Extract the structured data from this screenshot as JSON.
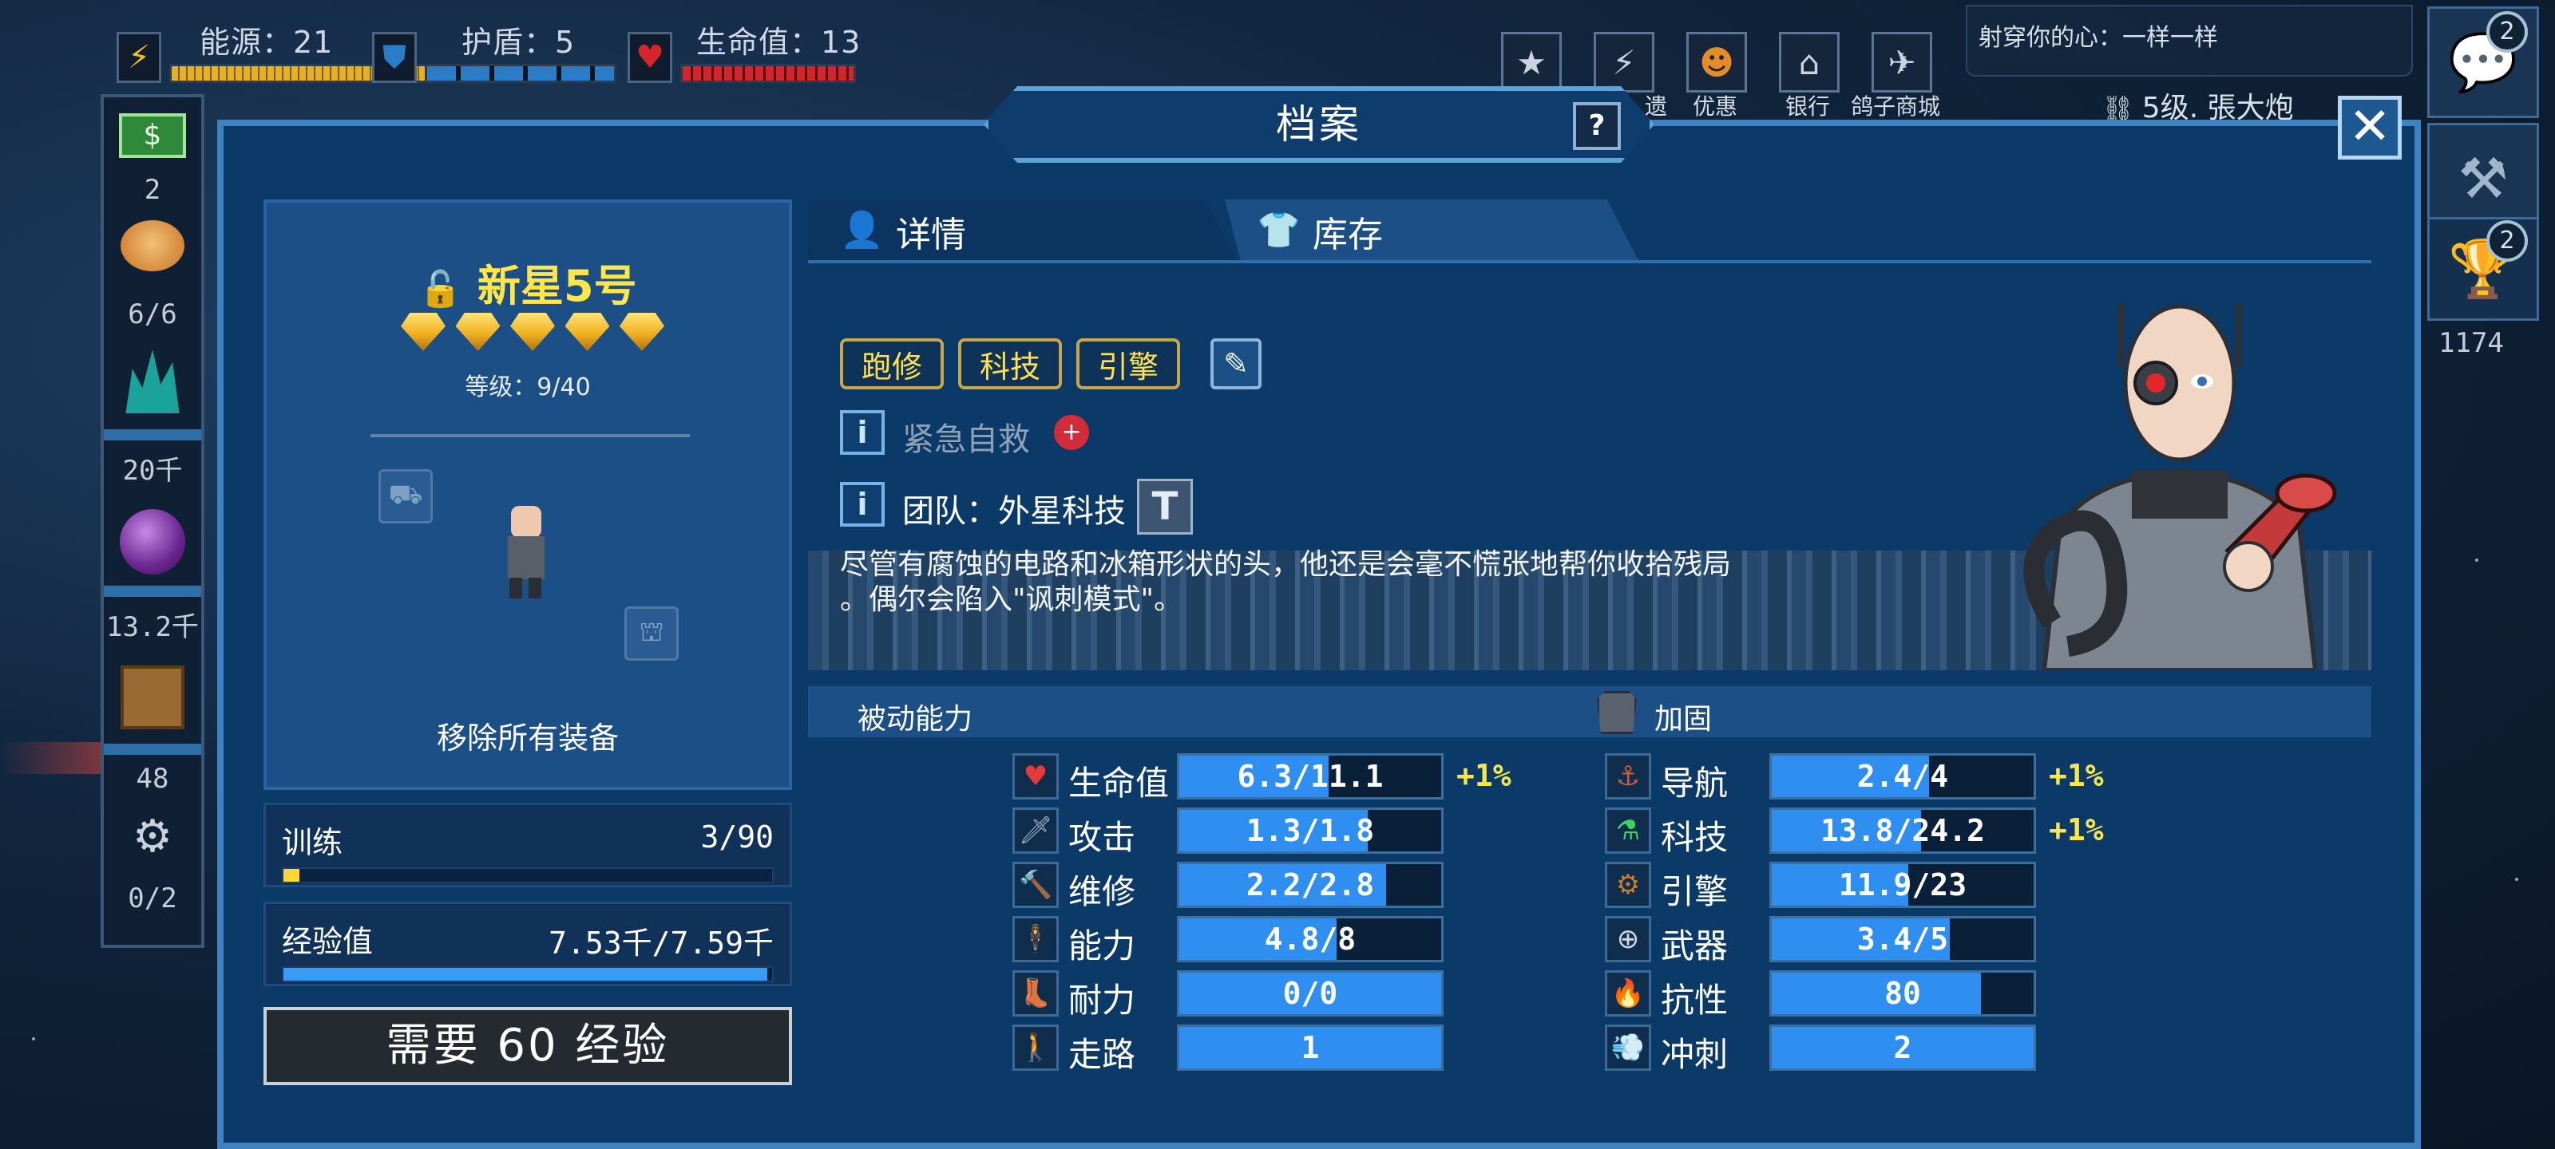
{
  "colors": {
    "accent": "#3e83c0",
    "energy": "#e6b11e",
    "shield": "#2a7cc7",
    "health": "#d2262c",
    "stat_fill": "#2f8ff0",
    "bonus": "#f4e64b",
    "crew_name": "#ffe74a"
  },
  "topbar": {
    "energy_label": "能源：21",
    "shield_label": "护盾：5",
    "health_label": "生命值：13",
    "energy_icon": "lightning-icon",
    "shield_icon": "shield-icon",
    "health_icon": "heart-icon"
  },
  "top_menu": [
    {
      "icon": "star-badge-icon",
      "label": ""
    },
    {
      "icon": "lightning-badge-icon",
      "label": "遗"
    },
    {
      "icon": "pumpkin-icon",
      "label": "优惠"
    },
    {
      "icon": "bank-icon",
      "label": "银行"
    },
    {
      "icon": "pigeon-icon",
      "label": "鸽子商城"
    }
  ],
  "message": "射穿你的心：一样一样",
  "player": {
    "level_text": "5级. 張大炮"
  },
  "sidebar": {
    "money_count": "2",
    "crew_count": "6/6",
    "crystal_count": "20千",
    "orb_count": "13.2千",
    "box_count": "48",
    "drone_count": "0/2"
  },
  "right_sidebar": {
    "chat_badge": "2",
    "trophy_badge": "2",
    "trophy_count": "1174"
  },
  "dialog": {
    "title": "档案",
    "help": "?",
    "close": "✕"
  },
  "crew": {
    "name": "新星5号",
    "level": "等级：9/40",
    "stars": 5,
    "remove_all": "移除所有装备",
    "train_label": "训练",
    "train_value": "3/90",
    "train_progress": 0.033,
    "xp_label": "经验值",
    "xp_value": "7.53千/7.59千",
    "xp_progress": 0.99,
    "need_xp_button": "需要 60 经验"
  },
  "tabs": {
    "details": "详情",
    "inventory": "库存"
  },
  "details": {
    "traits": [
      "跑修",
      "科技",
      "引擎"
    ],
    "ability": "紧急自救",
    "team": "团队：外星科技",
    "description_line1": "尽管有腐蚀的电路和冰箱形状的头，他还是会毫不慌张地帮你收拾残局",
    "description_line2": "。偶尔会陷入\"讽刺模式\"。"
  },
  "sections": {
    "passive": "被动能力",
    "reinforce": "加固"
  },
  "stats_left": [
    {
      "icon": "heart-icon",
      "label": "生命值",
      "value": "6.3/11.1",
      "progress": 0.57,
      "bonus": "+1%"
    },
    {
      "icon": "sword-icon",
      "label": "攻击",
      "value": "1.3/1.8",
      "progress": 0.72,
      "bonus": ""
    },
    {
      "icon": "hammer-icon",
      "label": "维修",
      "value": "2.2/2.8",
      "progress": 0.79,
      "bonus": ""
    },
    {
      "icon": "person-icon",
      "label": "能力",
      "value": "4.8/8",
      "progress": 0.6,
      "bonus": ""
    },
    {
      "icon": "boot-icon",
      "label": "耐力",
      "value": "0/0",
      "progress": 1.0,
      "bonus": ""
    },
    {
      "icon": "walking-icon",
      "label": "走路",
      "value": "1",
      "progress": 1.0,
      "bonus": ""
    }
  ],
  "stats_right": [
    {
      "icon": "navigation-icon",
      "label": "导航",
      "value": "2.4/4",
      "progress": 0.6,
      "bonus": "+1%"
    },
    {
      "icon": "flask-icon",
      "label": "科技",
      "value": "13.8/24.2",
      "progress": 0.57,
      "bonus": "+1%"
    },
    {
      "icon": "engine-icon",
      "label": "引擎",
      "value": "11.9/23",
      "progress": 0.52,
      "bonus": ""
    },
    {
      "icon": "crosshair-icon",
      "label": "武器",
      "value": "3.4/5",
      "progress": 0.68,
      "bonus": ""
    },
    {
      "icon": "fire-icon",
      "label": "抗性",
      "value": "80",
      "progress": 0.8,
      "bonus": ""
    },
    {
      "icon": "dash-icon",
      "label": "冲刺",
      "value": "2",
      "progress": 1.0,
      "bonus": ""
    }
  ]
}
